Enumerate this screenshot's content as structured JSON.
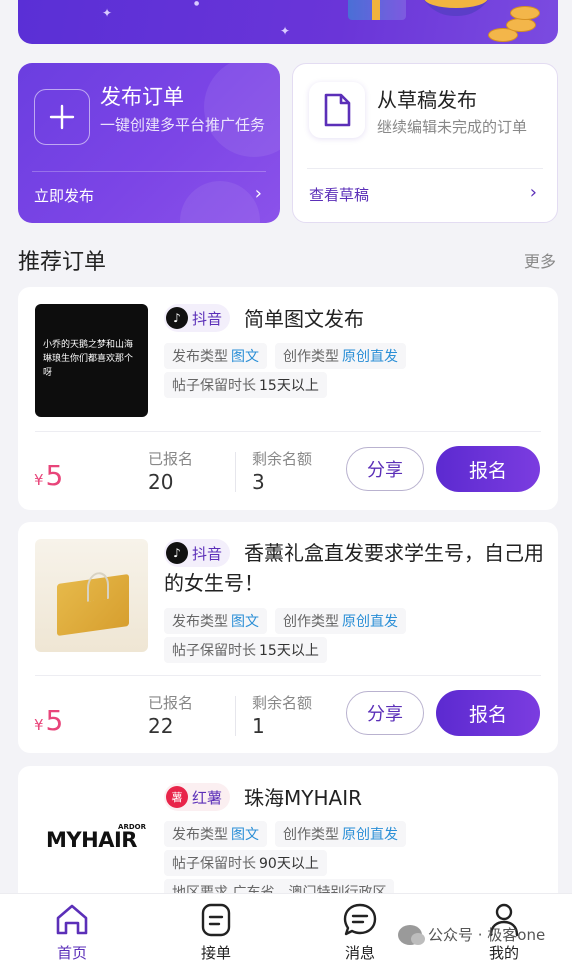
{
  "colors": {
    "accent": "#5b2fb8",
    "price": "#e8457a",
    "tag_value": "#2b8fd6"
  },
  "quick_actions": {
    "publish": {
      "title": "发布订单",
      "subtitle": "一键创建多平台推广任务",
      "link": "立即发布",
      "icon": "plus-icon"
    },
    "draft": {
      "title": "从草稿发布",
      "subtitle": "继续编辑未完成的订单",
      "link": "查看草稿",
      "icon": "document-icon"
    }
  },
  "section": {
    "title": "推荐订单",
    "more": "更多"
  },
  "orders": [
    {
      "platform": "抖音",
      "platform_icon": "douyin-icon",
      "title": "简单图文发布",
      "thumb_text": "小乔的天鹅之梦和山海琳琅生你们都喜欢那个呀",
      "tag_type_label": "发布类型",
      "tag_type_value": "图文",
      "tag_create_label": "创作类型",
      "tag_create_value": "原创直发",
      "tag_keep_label": "帖子保留时长",
      "tag_keep_value": "15天以上",
      "currency": "¥",
      "price": "5",
      "registered_label": "已报名",
      "registered": "20",
      "remaining_label": "剩余名额",
      "remaining": "3",
      "share": "分享",
      "apply": "报名"
    },
    {
      "platform": "抖音",
      "platform_icon": "douyin-icon",
      "title": "香薰礼盒直发要求学生号，自己用的女生号！",
      "tag_type_label": "发布类型",
      "tag_type_value": "图文",
      "tag_create_label": "创作类型",
      "tag_create_value": "原创直发",
      "tag_keep_label": "帖子保留时长",
      "tag_keep_value": "15天以上",
      "currency": "¥",
      "price": "5",
      "registered_label": "已报名",
      "registered": "22",
      "remaining_label": "剩余名额",
      "remaining": "1",
      "share": "分享",
      "apply": "报名"
    },
    {
      "platform": "红薯",
      "platform_icon": "hongshu-icon",
      "platform_icon_text": "薯",
      "title": "珠海MYHAIR",
      "thumb_logo": "MYHAIR",
      "thumb_logo_small": "ARDOR",
      "tag_type_label": "发布类型",
      "tag_type_value": "图文",
      "tag_create_label": "创作类型",
      "tag_create_value": "原创直发",
      "tag_keep_label": "帖子保留时长",
      "tag_keep_value": "90天以上",
      "tag_area": "地区要求 广东省、澳门特别行政区"
    }
  ],
  "tabbar": [
    {
      "label": "首页",
      "icon": "home-icon",
      "active": true
    },
    {
      "label": "接单",
      "icon": "clipboard-icon",
      "active": false
    },
    {
      "label": "消息",
      "icon": "chat-icon",
      "active": false
    },
    {
      "label": "我的",
      "icon": "user-icon",
      "active": false
    }
  ],
  "watermark": {
    "text": "公众号 · 极客one"
  }
}
